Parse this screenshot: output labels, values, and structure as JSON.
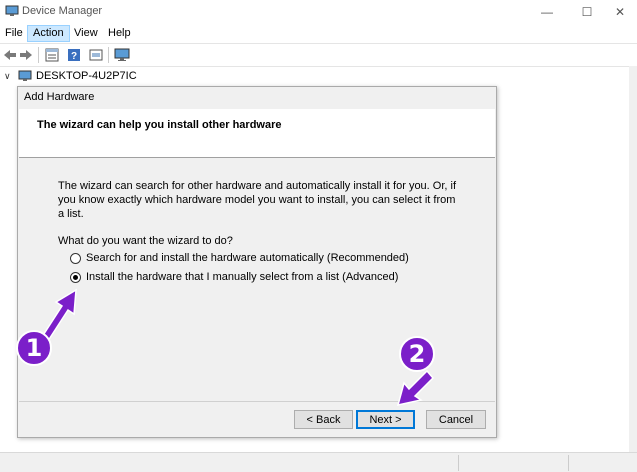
{
  "window": {
    "title": "Device Manager",
    "minimize_glyph": "—",
    "maximize_glyph": "☐",
    "close_glyph": "✕"
  },
  "menu": {
    "file": "File",
    "action": "Action",
    "view": "View",
    "help": "Help"
  },
  "toolbar": {
    "icons": [
      "back-arrow-icon",
      "forward-arrow-icon",
      "properties-icon",
      "help-icon",
      "update-driver-icon",
      "monitor-icon"
    ]
  },
  "tree": {
    "root": "DESKTOP-4U2P7IC"
  },
  "dialog": {
    "title": "Add Hardware",
    "heading": "The wizard can help you install other hardware",
    "description": "The wizard can search for other hardware and automatically install it for you. Or, if you know exactly which hardware model you want to install, you can select it from a list.",
    "question": "What do you want the wizard to do?",
    "options": [
      {
        "label": "Search for and install the hardware automatically (Recommended)",
        "selected": false
      },
      {
        "label": "Install the hardware that I manually select from a list (Advanced)",
        "selected": true
      }
    ],
    "buttons": {
      "back": "< Back",
      "next": "Next >",
      "cancel": "Cancel"
    }
  },
  "annotations": {
    "step1": "1",
    "step2": "2",
    "color": "#7b1fc9"
  },
  "colors": {
    "menu_highlight": "#cce8ff",
    "default_button_border": "#0078d7",
    "dialog_bg": "#f0f0f0"
  }
}
